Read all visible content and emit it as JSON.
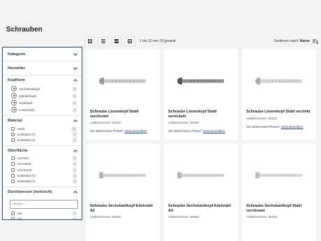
{
  "page": {
    "title": "Schrauben"
  },
  "filters": {
    "kategorie": "Kategorie",
    "hersteller": "Hersteller",
    "kopfform": {
      "label": "Kopfform",
      "options": [
        {
          "label": "Sechskantkopf",
          "count": "5"
        },
        {
          "label": "Zylinderkopf",
          "count": "5"
        },
        {
          "label": "Senkkopf",
          "count": "5"
        },
        {
          "label": "Linsenkopf",
          "count": "5"
        }
      ]
    },
    "material": {
      "label": "Material",
      "options": [
        {
          "label": "Stahl",
          "count": "15"
        },
        {
          "label": "Edelstahl A2",
          "count": "2"
        },
        {
          "label": "Edelstahl A4",
          "count": "2"
        }
      ]
    },
    "oberflaeche": {
      "label": "Oberfläche",
      "options": [
        {
          "label": "verzinkt",
          "count": "5"
        },
        {
          "label": "vernickelt",
          "count": "5"
        },
        {
          "label": "verchromt",
          "count": "5"
        },
        {
          "label": "Edelstahl A2",
          "count": "2"
        },
        {
          "label": "Edelstahl A4",
          "count": "2"
        }
      ]
    },
    "durchmesser": {
      "label": "Durchmesser (metrisch)",
      "search_placeholder": "Suche ...",
      "options": [
        {
          "label": "M2",
          "count": "7"
        },
        {
          "label": "M3",
          "count": "7"
        }
      ]
    }
  },
  "toolbar": {
    "results_text": "1 bis 12 von 19 gesamt",
    "sort_prefix": "Sortieren nach",
    "sort_value": "Name"
  },
  "products": [
    {
      "title": "Schraube Linsenkopf Stahl verchromt",
      "artnr": "Artikelnummer: 60230",
      "price_text": "Sie sehen keine Preise?",
      "price_link": "Jetzt anmelden!"
    },
    {
      "title": "Schraube Linsenkopf Stahl vernickelt",
      "artnr": "Artikelnummer: 60220",
      "price_text": "Sie sehen keine Preise?",
      "price_link": "Jetzt anmelden!"
    },
    {
      "title": "Schraube Linsenkopf Stahl verzinkt",
      "artnr": "Artikelnummer: 60210",
      "price_text": "Sie sehen keine Preise?",
      "price_link": "Jetzt anmelden!"
    },
    {
      "title": "Schraube Sechskantkopf Edelstahl A2",
      "artnr": "Artikelnummer: 90340"
    },
    {
      "title": "Schraube Sechskantkopf Edelstahl A4",
      "artnr": "Artikelnummer: 90350"
    },
    {
      "title": "Schraube Sechskantkopf Stahl verchromt",
      "artnr": "Artikelnummer: 90230"
    }
  ]
}
